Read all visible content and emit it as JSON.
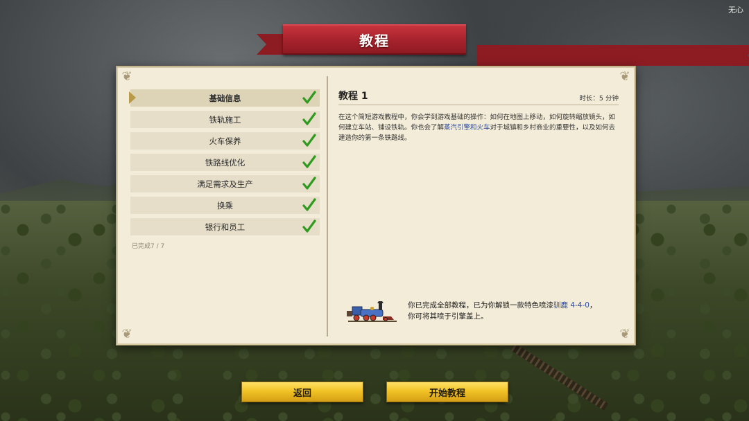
{
  "watermark": "无心",
  "header": {
    "title": "教程"
  },
  "sidebar": {
    "items": [
      {
        "label": "基础信息",
        "completed": true,
        "active": true
      },
      {
        "label": "铁轨施工",
        "completed": true,
        "active": false
      },
      {
        "label": "火车保养",
        "completed": true,
        "active": false
      },
      {
        "label": "铁路线优化",
        "completed": true,
        "active": false
      },
      {
        "label": "满足需求及生产",
        "completed": true,
        "active": false
      },
      {
        "label": "换乘",
        "completed": true,
        "active": false
      },
      {
        "label": "银行和员工",
        "completed": true,
        "active": false
      }
    ],
    "completed_text": "已完成7 / 7"
  },
  "detail": {
    "title": "教程 1",
    "duration": "时长：5 分钟",
    "desc_part1": "在这个简短游戏教程中，你会学到游戏基础的操作：如何在地图上移动，如何旋转缩放镜头，如何建立车站、铺设铁轨。你也会了解",
    "desc_link": "蒸汽引擎和火车",
    "desc_part2": "对于城镇和乡村商业的重要性，以及如何去建造你的第一条铁路线。",
    "reward_line1_prefix": "你已完成全部教程，已为你解锁一款特色喷漆",
    "reward_link": "驯鹿 4-4-0",
    "reward_line1_suffix": "，",
    "reward_line2": "你可将其喷于引擎盖上。"
  },
  "buttons": {
    "back": "返回",
    "start": "开始教程"
  },
  "colors": {
    "ribbon": "#a5222c",
    "button": "#f2c326",
    "check": "#2e9a1e",
    "link": "#2d4a9c"
  }
}
